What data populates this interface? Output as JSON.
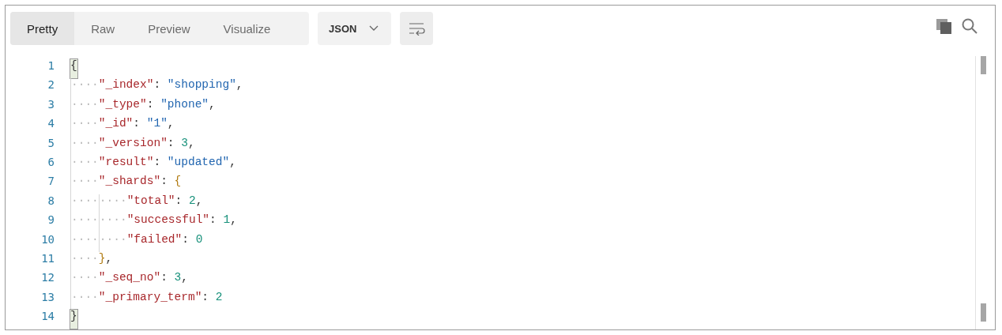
{
  "view_tabs": [
    {
      "label": "Pretty",
      "selected": true
    },
    {
      "label": "Raw",
      "selected": false
    },
    {
      "label": "Preview",
      "selected": false
    },
    {
      "label": "Visualize",
      "selected": false
    }
  ],
  "format_dropdown": {
    "value": "JSON"
  },
  "code_lines": [
    {
      "number": "1",
      "tokens": [
        {
          "kind": "match",
          "text": "{"
        }
      ]
    },
    {
      "number": "2",
      "tokens": [
        {
          "kind": "indent",
          "text": "····"
        },
        {
          "kind": "key",
          "text": "\"_index\""
        },
        {
          "kind": "punct",
          "text": ": "
        },
        {
          "kind": "string",
          "text": "\"shopping\""
        },
        {
          "kind": "punct",
          "text": ","
        }
      ]
    },
    {
      "number": "3",
      "tokens": [
        {
          "kind": "indent",
          "text": "····"
        },
        {
          "kind": "key",
          "text": "\"_type\""
        },
        {
          "kind": "punct",
          "text": ": "
        },
        {
          "kind": "string",
          "text": "\"phone\""
        },
        {
          "kind": "punct",
          "text": ","
        }
      ]
    },
    {
      "number": "4",
      "tokens": [
        {
          "kind": "indent",
          "text": "····"
        },
        {
          "kind": "key",
          "text": "\"_id\""
        },
        {
          "kind": "punct",
          "text": ": "
        },
        {
          "kind": "string",
          "text": "\"1\""
        },
        {
          "kind": "punct",
          "text": ","
        }
      ]
    },
    {
      "number": "5",
      "tokens": [
        {
          "kind": "indent",
          "text": "····"
        },
        {
          "kind": "key",
          "text": "\"_version\""
        },
        {
          "kind": "punct",
          "text": ": "
        },
        {
          "kind": "number",
          "text": "3"
        },
        {
          "kind": "punct",
          "text": ","
        }
      ]
    },
    {
      "number": "6",
      "tokens": [
        {
          "kind": "indent",
          "text": "····"
        },
        {
          "kind": "key",
          "text": "\"result\""
        },
        {
          "kind": "punct",
          "text": ": "
        },
        {
          "kind": "string",
          "text": "\"updated\""
        },
        {
          "kind": "punct",
          "text": ","
        }
      ]
    },
    {
      "number": "7",
      "tokens": [
        {
          "kind": "indent",
          "text": "····"
        },
        {
          "kind": "key",
          "text": "\"_shards\""
        },
        {
          "kind": "punct",
          "text": ": "
        },
        {
          "kind": "brace",
          "text": "{"
        }
      ]
    },
    {
      "number": "8",
      "tokens": [
        {
          "kind": "indent",
          "text": "····"
        },
        {
          "kind": "indent",
          "text": "····"
        },
        {
          "kind": "key",
          "text": "\"total\""
        },
        {
          "kind": "punct",
          "text": ": "
        },
        {
          "kind": "number",
          "text": "2"
        },
        {
          "kind": "punct",
          "text": ","
        }
      ]
    },
    {
      "number": "9",
      "tokens": [
        {
          "kind": "indent",
          "text": "····"
        },
        {
          "kind": "indent",
          "text": "····"
        },
        {
          "kind": "key",
          "text": "\"successful\""
        },
        {
          "kind": "punct",
          "text": ": "
        },
        {
          "kind": "number",
          "text": "1"
        },
        {
          "kind": "punct",
          "text": ","
        }
      ]
    },
    {
      "number": "10",
      "tokens": [
        {
          "kind": "indent",
          "text": "····"
        },
        {
          "kind": "indent",
          "text": "····"
        },
        {
          "kind": "key",
          "text": "\"failed\""
        },
        {
          "kind": "punct",
          "text": ": "
        },
        {
          "kind": "number",
          "text": "0"
        }
      ]
    },
    {
      "number": "11",
      "tokens": [
        {
          "kind": "indent",
          "text": "····"
        },
        {
          "kind": "brace",
          "text": "}"
        },
        {
          "kind": "punct",
          "text": ","
        }
      ]
    },
    {
      "number": "12",
      "tokens": [
        {
          "kind": "indent",
          "text": "····"
        },
        {
          "kind": "key",
          "text": "\"_seq_no\""
        },
        {
          "kind": "punct",
          "text": ": "
        },
        {
          "kind": "number",
          "text": "3"
        },
        {
          "kind": "punct",
          "text": ","
        }
      ]
    },
    {
      "number": "13",
      "tokens": [
        {
          "kind": "indent",
          "text": "····"
        },
        {
          "kind": "key",
          "text": "\"_primary_term\""
        },
        {
          "kind": "punct",
          "text": ": "
        },
        {
          "kind": "number",
          "text": "2"
        }
      ]
    },
    {
      "number": "14",
      "tokens": [
        {
          "kind": "match",
          "text": "}"
        }
      ]
    }
  ]
}
